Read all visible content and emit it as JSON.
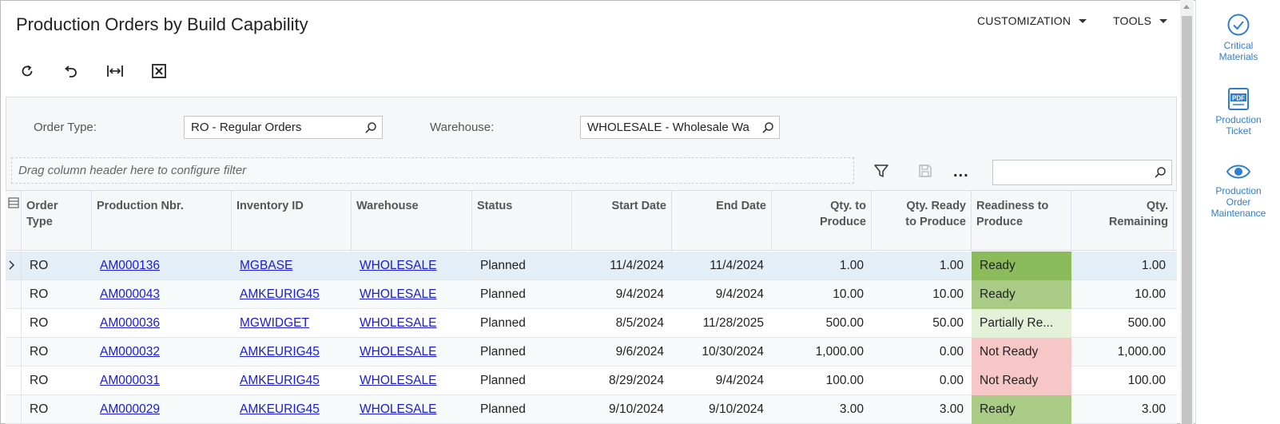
{
  "page": {
    "title": "Production Orders by Build Capability"
  },
  "top_menu": {
    "customization": "CUSTOMIZATION",
    "tools": "TOOLS"
  },
  "toolbar": {
    "refresh_icon": "refresh-icon",
    "undo_icon": "undo-icon",
    "fit_columns_icon": "fit-columns-icon",
    "excel_icon": "excel-export-icon"
  },
  "filters": {
    "order_type_label": "Order Type:",
    "order_type_value": "RO - Regular Orders",
    "warehouse_label": "Warehouse:",
    "warehouse_value": "WHOLESALE - Wholesale Wa"
  },
  "grid_toolbar": {
    "filter_placeholder": "Drag column header here to configure filter",
    "more": "..."
  },
  "columns": {
    "order_type": [
      "Order",
      "Type"
    ],
    "production_nbr": "Production Nbr.",
    "inventory_id": "Inventory ID",
    "warehouse": "Warehouse",
    "status": "Status",
    "start_date": "Start Date",
    "end_date": "End Date",
    "qty_to_produce": [
      "Qty. to",
      "Produce"
    ],
    "qty_ready": [
      "Qty. Ready",
      "to Produce"
    ],
    "readiness": [
      "Readiness to",
      "Produce"
    ],
    "qty_remaining": [
      "Qty.",
      "Remaining"
    ]
  },
  "rows": [
    {
      "order_type": "RO",
      "production_nbr": "AM000136",
      "inventory_id": "MGBASE",
      "warehouse": "WHOLESALE",
      "status": "Planned",
      "start_date": "11/4/2024",
      "end_date": "11/4/2024",
      "qty_to_produce": "1.00",
      "qty_ready": "1.00",
      "readiness": "Ready",
      "readiness_color": "#8bbb5a",
      "qty_remaining": "1.00"
    },
    {
      "order_type": "RO",
      "production_nbr": "AM000043",
      "inventory_id": "AMKEURIG45",
      "warehouse": "WHOLESALE",
      "status": "Planned",
      "start_date": "9/4/2024",
      "end_date": "9/4/2024",
      "qty_to_produce": "10.00",
      "qty_ready": "10.00",
      "readiness": "Ready",
      "readiness_color": "#a9cb86",
      "qty_remaining": "10.00"
    },
    {
      "order_type": "RO",
      "production_nbr": "AM000036",
      "inventory_id": "MGWIDGET",
      "warehouse": "WHOLESALE",
      "status": "Planned",
      "start_date": "8/5/2024",
      "end_date": "11/28/2025",
      "qty_to_produce": "500.00",
      "qty_ready": "50.00",
      "readiness": "Partially Re...",
      "readiness_color": "#e4f0d7",
      "qty_remaining": "500.00"
    },
    {
      "order_type": "RO",
      "production_nbr": "AM000032",
      "inventory_id": "AMKEURIG45",
      "warehouse": "WHOLESALE",
      "status": "Planned",
      "start_date": "9/6/2024",
      "end_date": "10/30/2024",
      "qty_to_produce": "1,000.00",
      "qty_ready": "0.00",
      "readiness": "Not Ready",
      "readiness_color": "#f7c6c6",
      "qty_remaining": "1,000.00"
    },
    {
      "order_type": "RO",
      "production_nbr": "AM000031",
      "inventory_id": "AMKEURIG45",
      "warehouse": "WHOLESALE",
      "status": "Planned",
      "start_date": "8/29/2024",
      "end_date": "9/4/2024",
      "qty_to_produce": "100.00",
      "qty_ready": "0.00",
      "readiness": "Not Ready",
      "readiness_color": "#f7c6c6",
      "qty_remaining": "100.00"
    },
    {
      "order_type": "RO",
      "production_nbr": "AM000029",
      "inventory_id": "AMKEURIG45",
      "warehouse": "WHOLESALE",
      "status": "Planned",
      "start_date": "9/10/2024",
      "end_date": "9/10/2024",
      "qty_to_produce": "3.00",
      "qty_ready": "3.00",
      "readiness": "Ready",
      "readiness_color": "#a9cb86",
      "qty_remaining": "3.00"
    }
  ],
  "right_panel": [
    {
      "label": [
        "Critical",
        "Materials"
      ],
      "icon": "check-circle-icon"
    },
    {
      "label": [
        "Production",
        "Ticket"
      ],
      "icon": "pdf-icon"
    },
    {
      "label": [
        "Production",
        "Order",
        "Maintenance"
      ],
      "icon": "eye-icon"
    }
  ],
  "colors": {
    "link": "#1a1ad6",
    "accent": "#2f7dd1",
    "ready": "#a9cb86",
    "not_ready": "#f7c6c6"
  }
}
